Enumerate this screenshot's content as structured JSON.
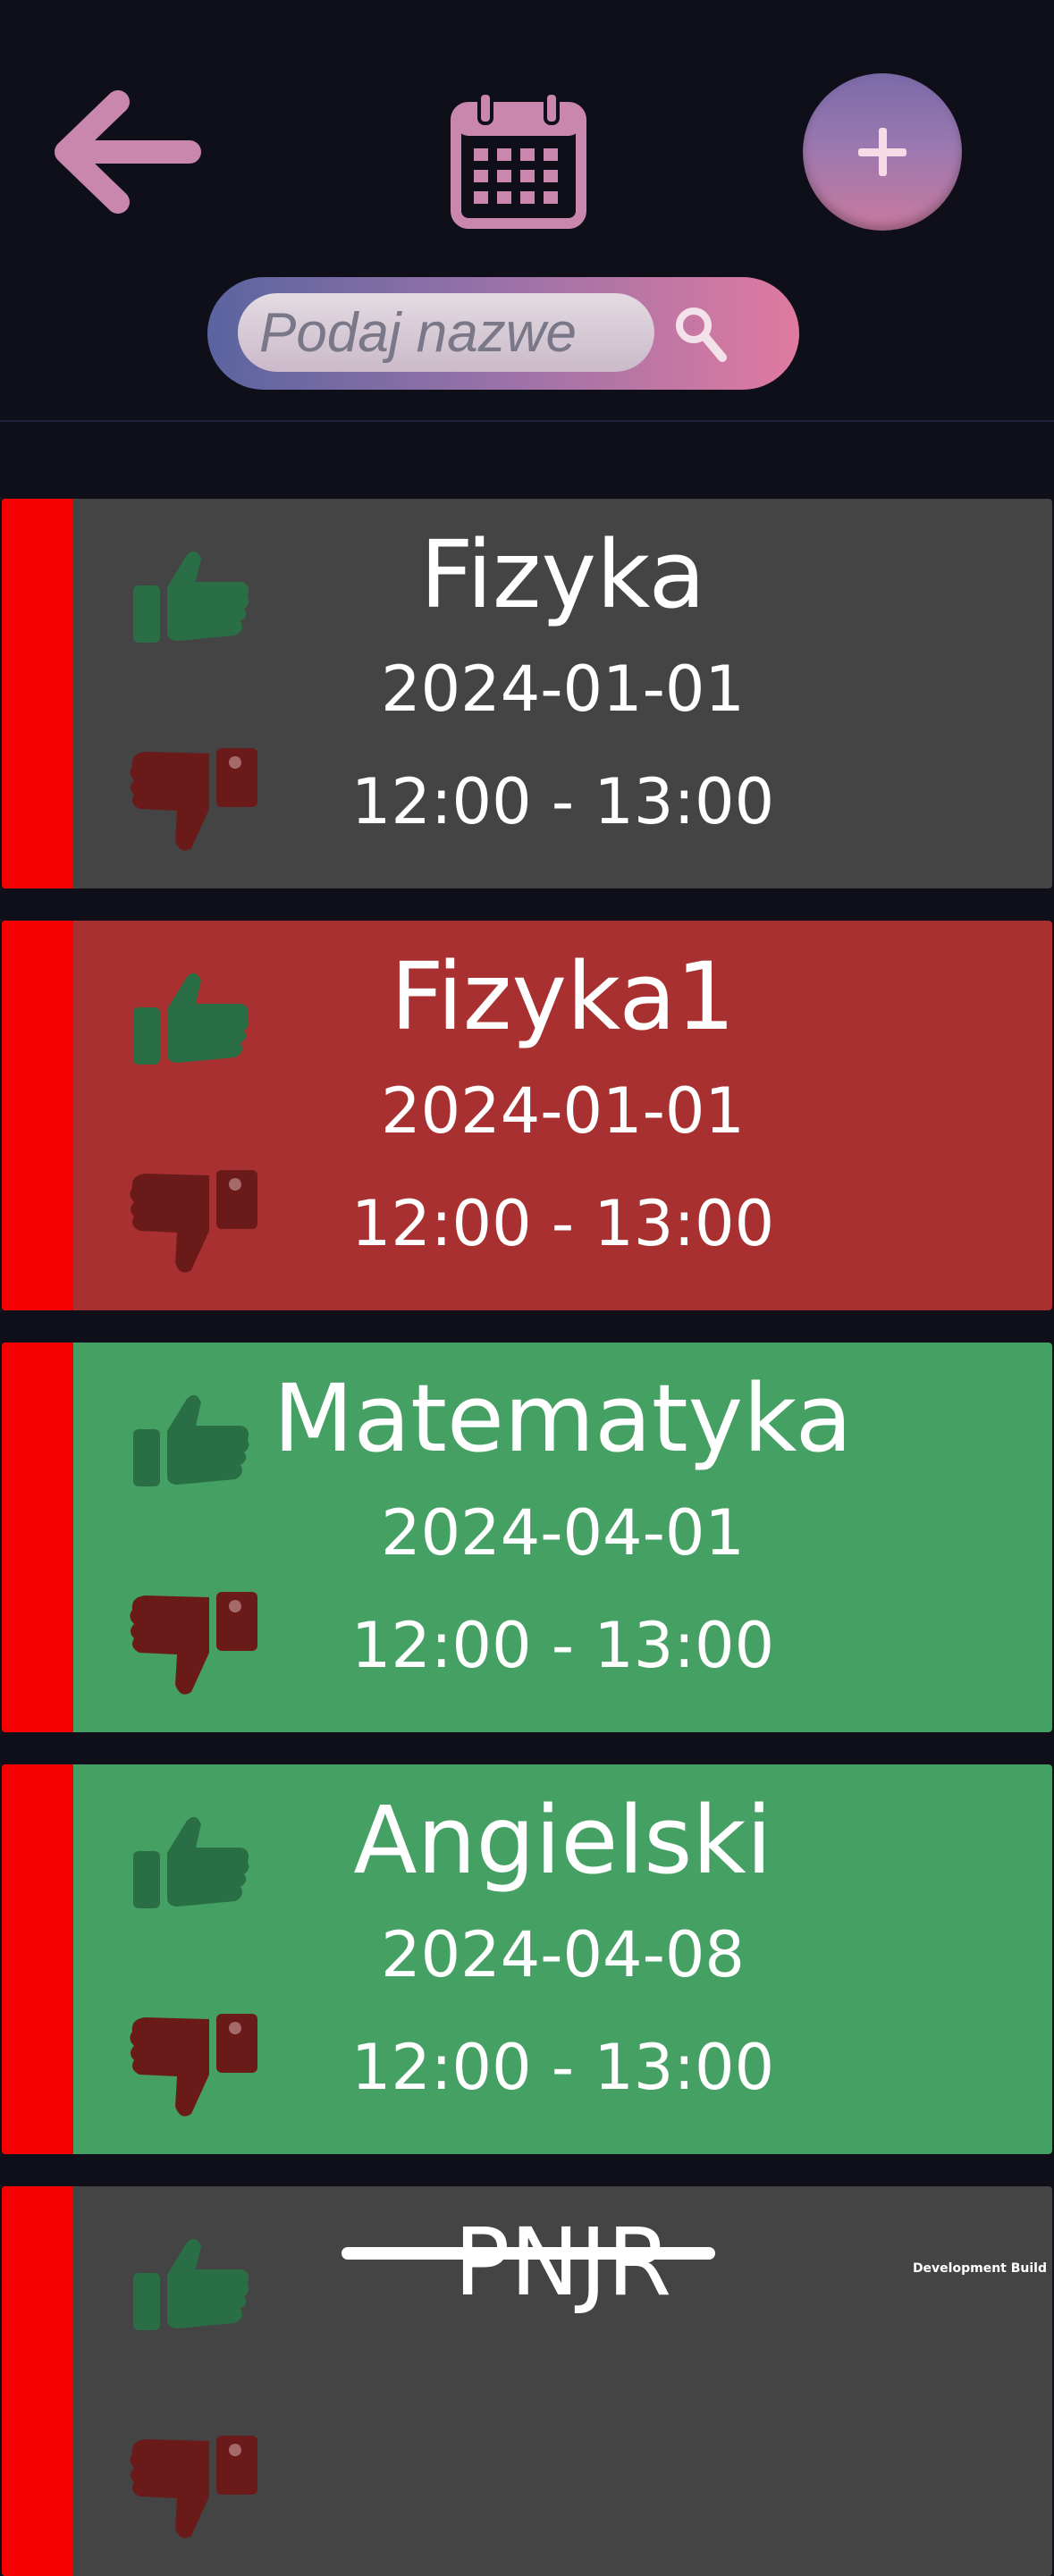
{
  "header": {
    "back_icon": "arrow-left-icon",
    "calendar_icon": "calendar-icon",
    "add_icon": "plus-icon",
    "search": {
      "placeholder": "Podaj nazwe",
      "value": "",
      "icon": "magnifier-icon"
    }
  },
  "colors": {
    "background": "#0f0f19",
    "stripe": "#f50000",
    "neutral_card": "#444444",
    "disliked_card": "#a93030",
    "liked_card": "#45a064",
    "thumb_up": "#2a6e45",
    "thumb_down": "#6b1a1a",
    "accent_pink": "#c987ad"
  },
  "lessons": [
    {
      "name": "Fizyka",
      "date": "2024-01-01",
      "time": "12:00 - 13:00",
      "color": "#444444"
    },
    {
      "name": "Fizyka1",
      "date": "2024-01-01",
      "time": "12:00 - 13:00",
      "color": "#a93030"
    },
    {
      "name": "Matematyka",
      "date": "2024-04-01",
      "time": "12:00 - 13:00",
      "color": "#45a064"
    },
    {
      "name": "Angielski",
      "date": "2024-04-08",
      "time": "12:00 - 13:00",
      "color": "#45a064"
    },
    {
      "name": "PNJR",
      "date": "",
      "time": "",
      "color": "#444444"
    }
  ],
  "footer": {
    "dev_build": "Development Build"
  }
}
